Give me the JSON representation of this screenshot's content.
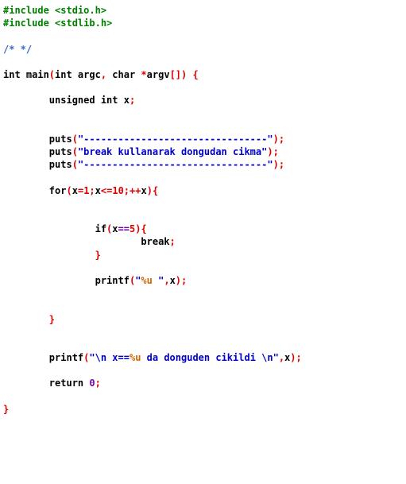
{
  "editor": {
    "title": "C source listing",
    "language": "C",
    "background": "#ffffff",
    "font_weight": "bold",
    "colors": {
      "plain": "#000000",
      "preprocessor": "#008000",
      "comment": "#3366cc",
      "string": "#0000cc",
      "punctuation": "#dd0000",
      "number_red": "#dd0000",
      "constant_purple": "#7700aa",
      "format_specifier": "#cc6600"
    }
  },
  "code": {
    "lines": [
      {
        "id": "line-1",
        "tokens": [
          {
            "text": "#include <stdio.h>",
            "type": "pre"
          }
        ]
      },
      {
        "id": "line-2",
        "tokens": [
          {
            "text": "#include <stdlib.h>",
            "type": "pre"
          }
        ]
      },
      {
        "id": "line-3",
        "tokens": []
      },
      {
        "id": "line-4",
        "tokens": [
          {
            "text": "/* */",
            "type": "comment"
          }
        ]
      },
      {
        "id": "line-5",
        "tokens": []
      },
      {
        "id": "line-6",
        "tokens": [
          {
            "text": "int main",
            "type": "plain"
          },
          {
            "text": "(",
            "type": "punct"
          },
          {
            "text": "int argc",
            "type": "plain"
          },
          {
            "text": ",",
            "type": "punct"
          },
          {
            "text": " char ",
            "type": "plain"
          },
          {
            "text": "*",
            "type": "punct"
          },
          {
            "text": "argv",
            "type": "plain"
          },
          {
            "text": "[]",
            "type": "punct"
          },
          {
            "text": ")",
            "type": "punct"
          },
          {
            "text": " ",
            "type": "plain"
          },
          {
            "text": "{",
            "type": "punct"
          }
        ]
      },
      {
        "id": "line-7",
        "tokens": []
      },
      {
        "id": "line-8",
        "tokens": [
          {
            "text": "        unsigned int x",
            "type": "plain"
          },
          {
            "text": ";",
            "type": "punct"
          }
        ]
      },
      {
        "id": "line-9",
        "tokens": []
      },
      {
        "id": "line-10",
        "tokens": []
      },
      {
        "id": "line-11",
        "tokens": [
          {
            "text": "        puts",
            "type": "plain"
          },
          {
            "text": "(",
            "type": "punct"
          },
          {
            "text": "\"--------------------------------\"",
            "type": "string"
          },
          {
            "text": ")",
            "type": "punct"
          },
          {
            "text": ";",
            "type": "punct"
          }
        ]
      },
      {
        "id": "line-12",
        "tokens": [
          {
            "text": "        puts",
            "type": "plain"
          },
          {
            "text": "(",
            "type": "punct"
          },
          {
            "text": "\"break kullanarak dongudan cikma\"",
            "type": "string"
          },
          {
            "text": ")",
            "type": "punct"
          },
          {
            "text": ";",
            "type": "punct"
          }
        ]
      },
      {
        "id": "line-13",
        "tokens": [
          {
            "text": "        puts",
            "type": "plain"
          },
          {
            "text": "(",
            "type": "punct"
          },
          {
            "text": "\"--------------------------------\"",
            "type": "string"
          },
          {
            "text": ")",
            "type": "punct"
          },
          {
            "text": ";",
            "type": "punct"
          }
        ]
      },
      {
        "id": "line-14",
        "tokens": []
      },
      {
        "id": "line-15",
        "tokens": [
          {
            "text": "        for",
            "type": "plain"
          },
          {
            "text": "(",
            "type": "punct"
          },
          {
            "text": "x",
            "type": "plain"
          },
          {
            "text": "=",
            "type": "punct"
          },
          {
            "text": "1",
            "type": "number"
          },
          {
            "text": ";",
            "type": "punct"
          },
          {
            "text": "x",
            "type": "plain"
          },
          {
            "text": "<=",
            "type": "punct"
          },
          {
            "text": "10",
            "type": "number"
          },
          {
            "text": ";",
            "type": "punct"
          },
          {
            "text": "++",
            "type": "punct"
          },
          {
            "text": "x",
            "type": "plain"
          },
          {
            "text": ")",
            "type": "punct"
          },
          {
            "text": "{",
            "type": "punct"
          }
        ]
      },
      {
        "id": "line-16",
        "tokens": []
      },
      {
        "id": "line-17",
        "tokens": []
      },
      {
        "id": "line-18",
        "tokens": [
          {
            "text": "                if",
            "type": "plain"
          },
          {
            "text": "(",
            "type": "punct"
          },
          {
            "text": "x",
            "type": "plain"
          },
          {
            "text": "==",
            "type": "op"
          },
          {
            "text": "5",
            "type": "number"
          },
          {
            "text": ")",
            "type": "punct"
          },
          {
            "text": "{",
            "type": "punct"
          }
        ]
      },
      {
        "id": "line-19",
        "tokens": [
          {
            "text": "                        break",
            "type": "plain"
          },
          {
            "text": ";",
            "type": "punct"
          }
        ]
      },
      {
        "id": "line-20",
        "tokens": [
          {
            "text": "                ",
            "type": "plain"
          },
          {
            "text": "}",
            "type": "punct"
          }
        ]
      },
      {
        "id": "line-21",
        "tokens": []
      },
      {
        "id": "line-22",
        "tokens": [
          {
            "text": "                printf",
            "type": "plain"
          },
          {
            "text": "(",
            "type": "punct"
          },
          {
            "text": "\"",
            "type": "string"
          },
          {
            "text": "%u",
            "type": "fmt"
          },
          {
            "text": " \"",
            "type": "string"
          },
          {
            "text": ",",
            "type": "punct"
          },
          {
            "text": "x",
            "type": "plain"
          },
          {
            "text": ")",
            "type": "punct"
          },
          {
            "text": ";",
            "type": "punct"
          }
        ]
      },
      {
        "id": "line-23",
        "tokens": []
      },
      {
        "id": "line-24",
        "tokens": []
      },
      {
        "id": "line-25",
        "tokens": [
          {
            "text": "        ",
            "type": "plain"
          },
          {
            "text": "}",
            "type": "punct"
          }
        ]
      },
      {
        "id": "line-26",
        "tokens": []
      },
      {
        "id": "line-27",
        "tokens": []
      },
      {
        "id": "line-28",
        "tokens": [
          {
            "text": "        printf",
            "type": "plain"
          },
          {
            "text": "(",
            "type": "punct"
          },
          {
            "text": "\"\\n x==",
            "type": "string"
          },
          {
            "text": "%u",
            "type": "fmt"
          },
          {
            "text": " da donguden cikildi \\n\"",
            "type": "string"
          },
          {
            "text": ",",
            "type": "punct"
          },
          {
            "text": "x",
            "type": "plain"
          },
          {
            "text": ")",
            "type": "punct"
          },
          {
            "text": ";",
            "type": "punct"
          }
        ]
      },
      {
        "id": "line-29",
        "tokens": []
      },
      {
        "id": "line-30",
        "tokens": [
          {
            "text": "        return ",
            "type": "plain"
          },
          {
            "text": "0",
            "type": "const"
          },
          {
            "text": ";",
            "type": "punct"
          }
        ]
      },
      {
        "id": "line-31",
        "tokens": []
      },
      {
        "id": "line-32",
        "tokens": [
          {
            "text": "}",
            "type": "punct"
          }
        ]
      }
    ]
  }
}
